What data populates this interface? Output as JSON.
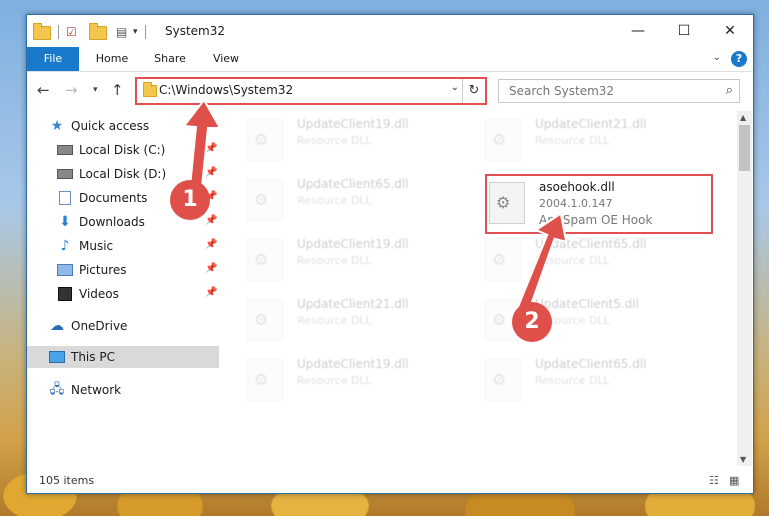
{
  "window": {
    "title": "System32",
    "minimize": "—",
    "maximize": "☐",
    "close": "✕"
  },
  "ribbon": {
    "tabs": [
      "File",
      "Home",
      "Share",
      "View"
    ],
    "help": "?"
  },
  "address": {
    "path": "C:\\Windows\\System32",
    "search_placeholder": "Search System32"
  },
  "nav": {
    "quick_access": "Quick access",
    "items": [
      {
        "label": "Local Disk (C:)",
        "icon": "drive-icon",
        "pinned": true
      },
      {
        "label": "Local Disk (D:)",
        "icon": "drive-icon",
        "pinned": true
      },
      {
        "label": "Documents",
        "icon": "documents-icon",
        "pinned": true
      },
      {
        "label": "Downloads",
        "icon": "downloads-icon",
        "pinned": true
      },
      {
        "label": "Music",
        "icon": "music-icon",
        "pinned": true
      },
      {
        "label": "Pictures",
        "icon": "pictures-icon",
        "pinned": true
      },
      {
        "label": "Videos",
        "icon": "videos-icon",
        "pinned": true
      }
    ],
    "onedrive": "OneDrive",
    "this_pc": "This PC",
    "network": "Network"
  },
  "files": {
    "col1": [
      {
        "name": "UpdateClient19.dll",
        "desc": "Resource DLL"
      },
      {
        "name": "UpdateClient65.dll",
        "desc": "Resource DLL"
      },
      {
        "name": "UpdateClient19.dll",
        "desc": "Resource DLL"
      },
      {
        "name": "UpdateClient21.dll",
        "desc": "Resource DLL"
      },
      {
        "name": "UpdateClient19.dll",
        "desc": "Resource DLL"
      }
    ],
    "col2": [
      {
        "name": "UpdateClient21.dll",
        "desc": "Resource DLL"
      },
      {
        "name": "UpdateClient65.dll",
        "desc": "Resource DLL"
      },
      {
        "name": "UpdateClient5.dll",
        "desc": "Resource DLL"
      },
      {
        "name": "UpdateClient65.dll",
        "desc": "Resource DLL"
      }
    ],
    "highlighted": {
      "name": "asoehook.dll",
      "version": "2004.1.0.147",
      "desc": "AntiSpam OE Hook"
    }
  },
  "status": {
    "count": "105 items"
  },
  "callouts": [
    "1",
    "2"
  ],
  "colors": {
    "accent": "#1979ca",
    "callout": "#e0504a"
  }
}
